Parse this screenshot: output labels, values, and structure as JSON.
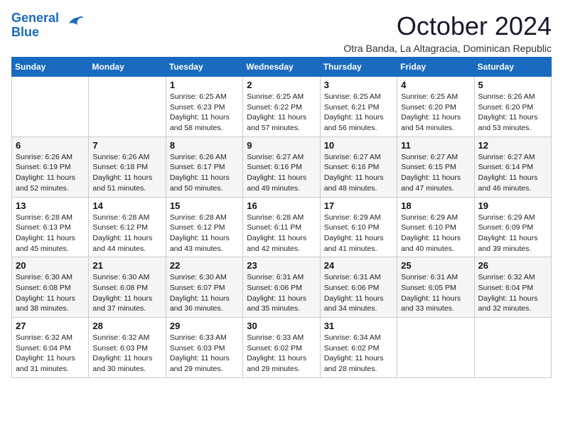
{
  "logo": {
    "line1": "General",
    "line2": "Blue"
  },
  "title": "October 2024",
  "subtitle": "Otra Banda, La Altagracia, Dominican Republic",
  "days_of_week": [
    "Sunday",
    "Monday",
    "Tuesday",
    "Wednesday",
    "Thursday",
    "Friday",
    "Saturday"
  ],
  "weeks": [
    [
      {
        "day": "",
        "info": ""
      },
      {
        "day": "",
        "info": ""
      },
      {
        "day": "1",
        "info": "Sunrise: 6:25 AM\nSunset: 6:23 PM\nDaylight: 11 hours and 58 minutes."
      },
      {
        "day": "2",
        "info": "Sunrise: 6:25 AM\nSunset: 6:22 PM\nDaylight: 11 hours and 57 minutes."
      },
      {
        "day": "3",
        "info": "Sunrise: 6:25 AM\nSunset: 6:21 PM\nDaylight: 11 hours and 56 minutes."
      },
      {
        "day": "4",
        "info": "Sunrise: 6:25 AM\nSunset: 6:20 PM\nDaylight: 11 hours and 54 minutes."
      },
      {
        "day": "5",
        "info": "Sunrise: 6:26 AM\nSunset: 6:20 PM\nDaylight: 11 hours and 53 minutes."
      }
    ],
    [
      {
        "day": "6",
        "info": "Sunrise: 6:26 AM\nSunset: 6:19 PM\nDaylight: 11 hours and 52 minutes."
      },
      {
        "day": "7",
        "info": "Sunrise: 6:26 AM\nSunset: 6:18 PM\nDaylight: 11 hours and 51 minutes."
      },
      {
        "day": "8",
        "info": "Sunrise: 6:26 AM\nSunset: 6:17 PM\nDaylight: 11 hours and 50 minutes."
      },
      {
        "day": "9",
        "info": "Sunrise: 6:27 AM\nSunset: 6:16 PM\nDaylight: 11 hours and 49 minutes."
      },
      {
        "day": "10",
        "info": "Sunrise: 6:27 AM\nSunset: 6:16 PM\nDaylight: 11 hours and 48 minutes."
      },
      {
        "day": "11",
        "info": "Sunrise: 6:27 AM\nSunset: 6:15 PM\nDaylight: 11 hours and 47 minutes."
      },
      {
        "day": "12",
        "info": "Sunrise: 6:27 AM\nSunset: 6:14 PM\nDaylight: 11 hours and 46 minutes."
      }
    ],
    [
      {
        "day": "13",
        "info": "Sunrise: 6:28 AM\nSunset: 6:13 PM\nDaylight: 11 hours and 45 minutes."
      },
      {
        "day": "14",
        "info": "Sunrise: 6:28 AM\nSunset: 6:12 PM\nDaylight: 11 hours and 44 minutes."
      },
      {
        "day": "15",
        "info": "Sunrise: 6:28 AM\nSunset: 6:12 PM\nDaylight: 11 hours and 43 minutes."
      },
      {
        "day": "16",
        "info": "Sunrise: 6:28 AM\nSunset: 6:11 PM\nDaylight: 11 hours and 42 minutes."
      },
      {
        "day": "17",
        "info": "Sunrise: 6:29 AM\nSunset: 6:10 PM\nDaylight: 11 hours and 41 minutes."
      },
      {
        "day": "18",
        "info": "Sunrise: 6:29 AM\nSunset: 6:10 PM\nDaylight: 11 hours and 40 minutes."
      },
      {
        "day": "19",
        "info": "Sunrise: 6:29 AM\nSunset: 6:09 PM\nDaylight: 11 hours and 39 minutes."
      }
    ],
    [
      {
        "day": "20",
        "info": "Sunrise: 6:30 AM\nSunset: 6:08 PM\nDaylight: 11 hours and 38 minutes."
      },
      {
        "day": "21",
        "info": "Sunrise: 6:30 AM\nSunset: 6:08 PM\nDaylight: 11 hours and 37 minutes."
      },
      {
        "day": "22",
        "info": "Sunrise: 6:30 AM\nSunset: 6:07 PM\nDaylight: 11 hours and 36 minutes."
      },
      {
        "day": "23",
        "info": "Sunrise: 6:31 AM\nSunset: 6:06 PM\nDaylight: 11 hours and 35 minutes."
      },
      {
        "day": "24",
        "info": "Sunrise: 6:31 AM\nSunset: 6:06 PM\nDaylight: 11 hours and 34 minutes."
      },
      {
        "day": "25",
        "info": "Sunrise: 6:31 AM\nSunset: 6:05 PM\nDaylight: 11 hours and 33 minutes."
      },
      {
        "day": "26",
        "info": "Sunrise: 6:32 AM\nSunset: 6:04 PM\nDaylight: 11 hours and 32 minutes."
      }
    ],
    [
      {
        "day": "27",
        "info": "Sunrise: 6:32 AM\nSunset: 6:04 PM\nDaylight: 11 hours and 31 minutes."
      },
      {
        "day": "28",
        "info": "Sunrise: 6:32 AM\nSunset: 6:03 PM\nDaylight: 11 hours and 30 minutes."
      },
      {
        "day": "29",
        "info": "Sunrise: 6:33 AM\nSunset: 6:03 PM\nDaylight: 11 hours and 29 minutes."
      },
      {
        "day": "30",
        "info": "Sunrise: 6:33 AM\nSunset: 6:02 PM\nDaylight: 11 hours and 29 minutes."
      },
      {
        "day": "31",
        "info": "Sunrise: 6:34 AM\nSunset: 6:02 PM\nDaylight: 11 hours and 28 minutes."
      },
      {
        "day": "",
        "info": ""
      },
      {
        "day": "",
        "info": ""
      }
    ]
  ]
}
